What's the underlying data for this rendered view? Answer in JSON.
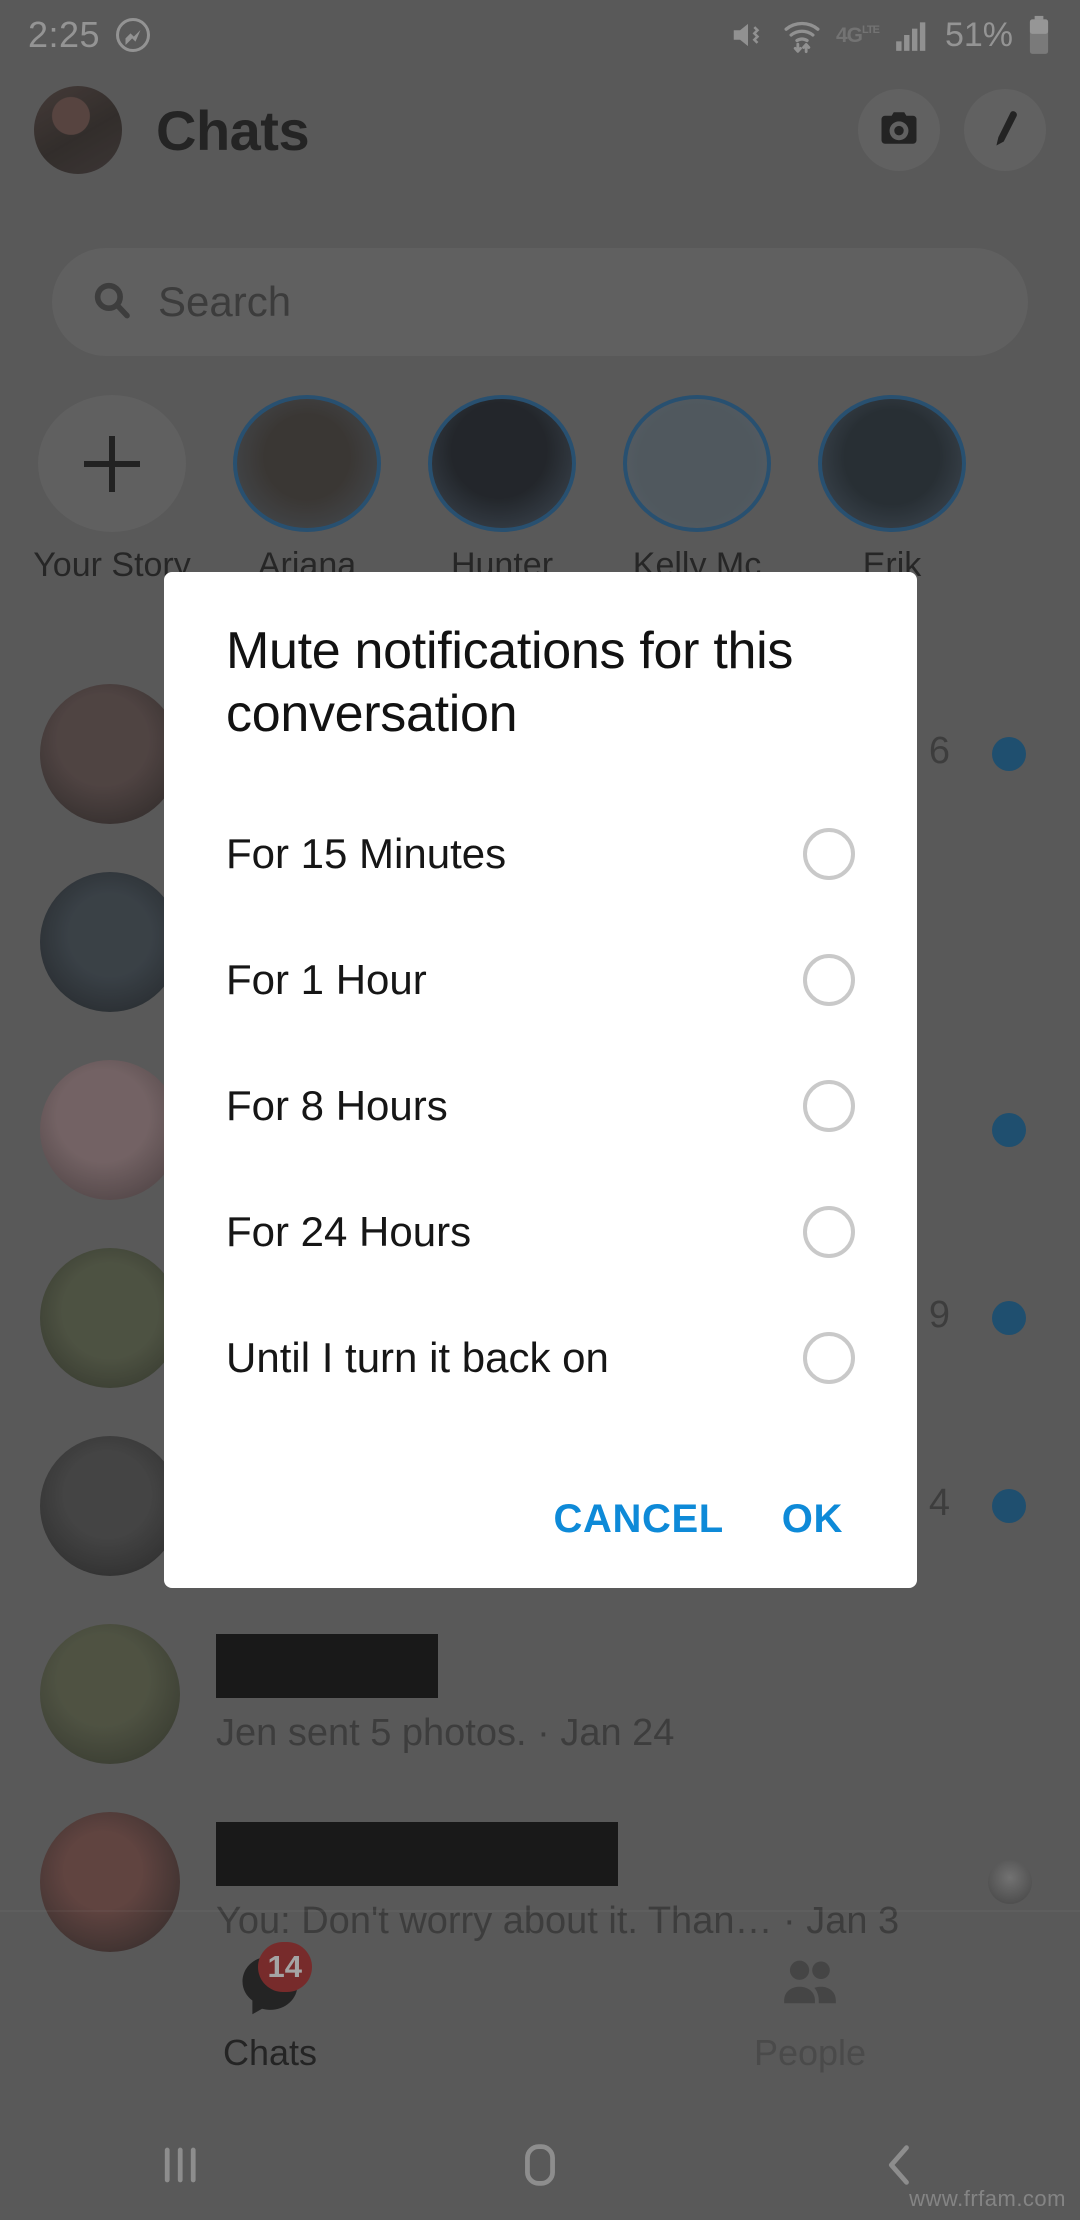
{
  "status_bar": {
    "time": "2:25",
    "messenger_icon": "messenger-icon",
    "mute_icon": "volume-mute-vibrate-icon",
    "wifi_icon": "wifi-data-transfer-icon",
    "network_label": "4G",
    "network_sup": "LTE",
    "signal_icon": "signal-bars-icon",
    "battery_percent": "51%",
    "battery_icon": "battery-icon"
  },
  "app_bar": {
    "title": "Chats",
    "avatar": "profile-avatar",
    "camera_icon": "camera-icon",
    "compose_icon": "pencil-compose-icon"
  },
  "search": {
    "placeholder": "Search",
    "icon": "search-icon"
  },
  "stories": [
    {
      "label": "Your Story",
      "type": "add"
    },
    {
      "label": "Ariana",
      "type": "s1"
    },
    {
      "label": "Hunter",
      "type": "s2"
    },
    {
      "label": "Kelly Mc",
      "type": "s3"
    },
    {
      "label": "Erik",
      "type": "s4"
    }
  ],
  "chats": [
    {
      "name_redacted": true,
      "preview": "",
      "time": "6",
      "unread": true,
      "avatar": "c1"
    },
    {
      "name_redacted": true,
      "preview": "",
      "time": "",
      "unread": false,
      "avatar": "c2"
    },
    {
      "name_redacted": true,
      "preview": "",
      "time": "",
      "unread": true,
      "avatar": "c3"
    },
    {
      "name_redacted": true,
      "preview": "",
      "time": "9",
      "unread": true,
      "avatar": "c4"
    },
    {
      "name_redacted": true,
      "preview": "",
      "time": "4",
      "unread": true,
      "avatar": "c5"
    },
    {
      "name_redacted": true,
      "preview": "Jen sent 5 photos. · Jan 24",
      "time": "",
      "unread": false,
      "avatar": "c6"
    },
    {
      "name_redacted": true,
      "preview": "You: Don't worry about it. Than… · Jan 3",
      "time": "",
      "unread": false,
      "avatar": "c7",
      "seen_avatar": true
    }
  ],
  "tab_bar": {
    "tabs": [
      {
        "label": "Chats",
        "icon": "chat-bubble-icon",
        "badge": "14",
        "active": true
      },
      {
        "label": "People",
        "icon": "people-icon",
        "badge": "",
        "active": false
      }
    ]
  },
  "nav_bar": {
    "recents_icon": "recents-icon",
    "home_icon": "home-icon",
    "back_icon": "back-icon"
  },
  "watermark": "www.frfam.com",
  "dialog": {
    "title": "Mute notifications for this conversation",
    "options": [
      {
        "label": "For 15 Minutes",
        "selected": false
      },
      {
        "label": "For 1 Hour",
        "selected": false
      },
      {
        "label": "For 8 Hours",
        "selected": false
      },
      {
        "label": "For 24 Hours",
        "selected": false
      },
      {
        "label": "Until I turn it back on",
        "selected": false
      }
    ],
    "cancel_label": "CANCEL",
    "ok_label": "OK"
  },
  "colors": {
    "accent_blue": "#0e8ad8",
    "unread_dot": "#0b5d94",
    "badge_red": "#a32020",
    "story_ring": "#1b5f96",
    "dialog_bg": "#ffffff",
    "scrim": "#6e6e6e"
  }
}
